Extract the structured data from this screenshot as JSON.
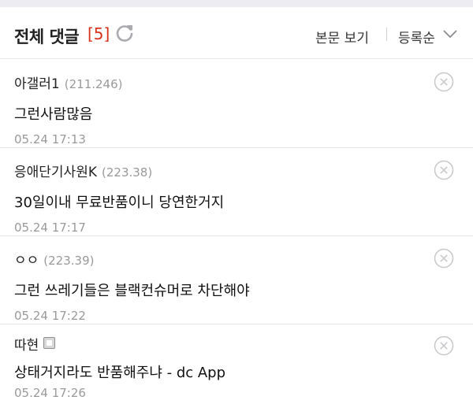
{
  "header": {
    "title": "전체 댓글",
    "count": "[5]",
    "view_body_label": "본문 보기",
    "sort_label": "등록순"
  },
  "comments": [
    {
      "nick": "아갤러1",
      "ip": "(211.246)",
      "text": "그런사람많음",
      "time": "05.24 17:13"
    },
    {
      "nick": "응애단기사원K",
      "ip": "(223.38)",
      "text": "30일이내 무료반품이니 당연한거지",
      "time": "05.24 17:17"
    },
    {
      "nick": "ㅇㅇ",
      "ip": "(223.39)",
      "text": "그런 쓰레기들은 블랙컨슈머로 차단해야",
      "time": "05.24 17:22"
    },
    {
      "nick": "따현",
      "ip": "",
      "text": "상태거지라도 반품해주냐 - dc App",
      "time": "05.24 17:26"
    }
  ],
  "icons": {
    "refresh": "refresh-icon",
    "sort_chevron": "chevron-down-icon",
    "delete": "close-circle-icon",
    "member_badge": "member-badge-icon"
  },
  "colors": {
    "count": "#d9301a",
    "secondary_text": "#999999",
    "icon_gray": "#c8c8cc"
  }
}
